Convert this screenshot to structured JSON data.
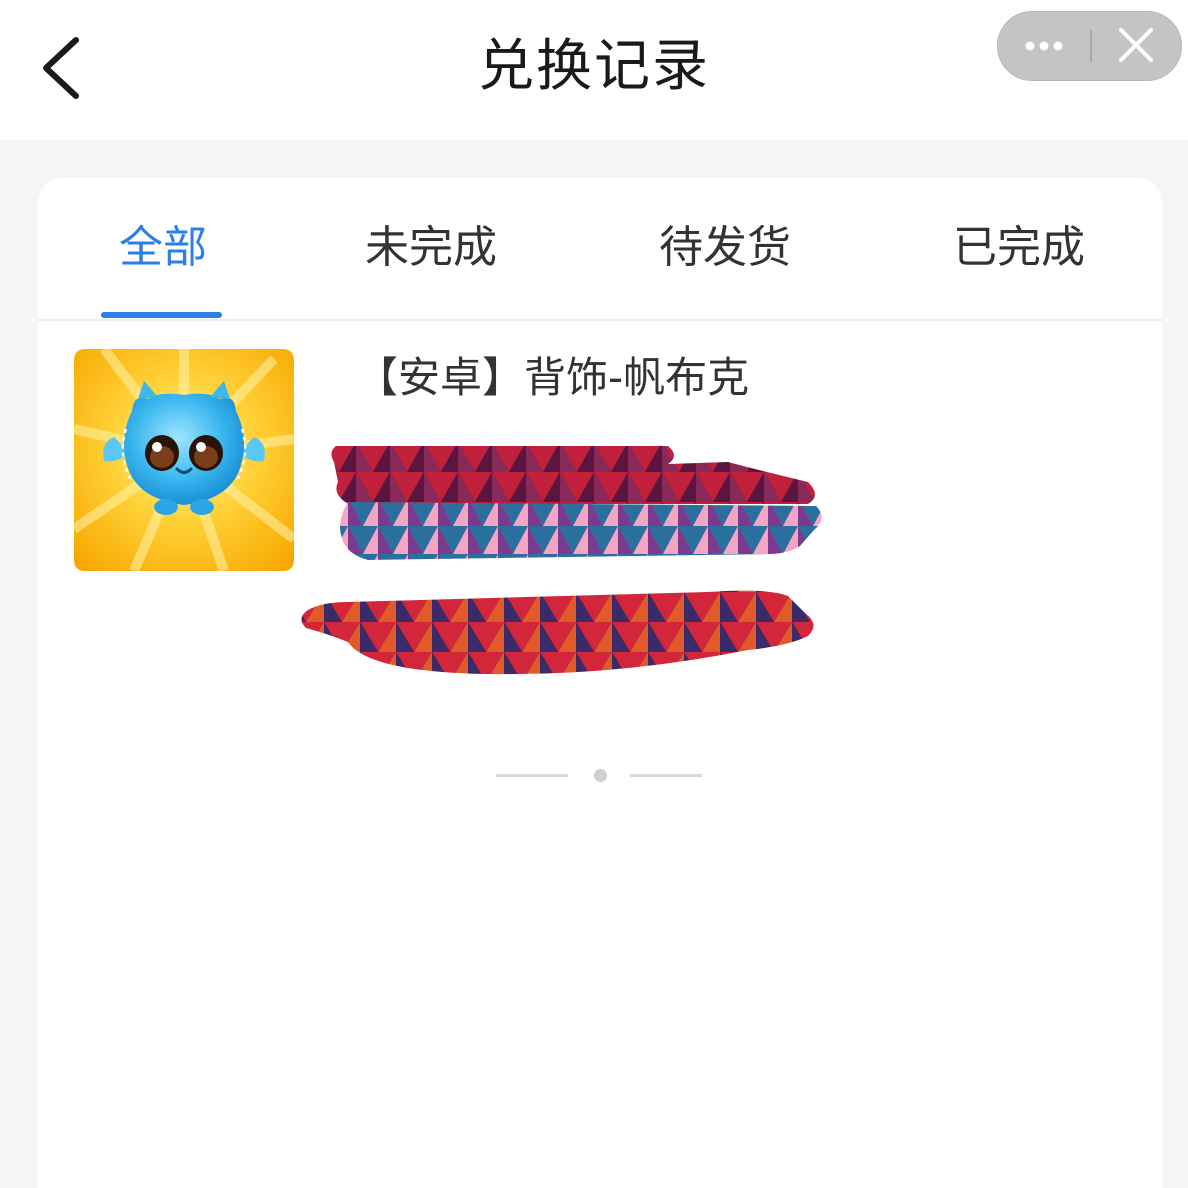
{
  "header": {
    "title": "兑换记录",
    "back_icon": "chevron-left-icon",
    "capsule": {
      "more_icon": "more-dots-icon",
      "close_icon": "close-icon"
    }
  },
  "tabs": [
    {
      "label": "全部",
      "active": true
    },
    {
      "label": "未完成",
      "active": false
    },
    {
      "label": "待发货",
      "active": false
    },
    {
      "label": "已完成",
      "active": false
    }
  ],
  "records": [
    {
      "title": "【安卓】背饰-帆布克",
      "thumbnail_icon": "blue-creature-icon",
      "redacted": true
    }
  ],
  "colors": {
    "accent": "#2b7fe6",
    "text": "#333333",
    "background": "#f4f5f7",
    "thumbnail_bg": "#ffc107"
  }
}
